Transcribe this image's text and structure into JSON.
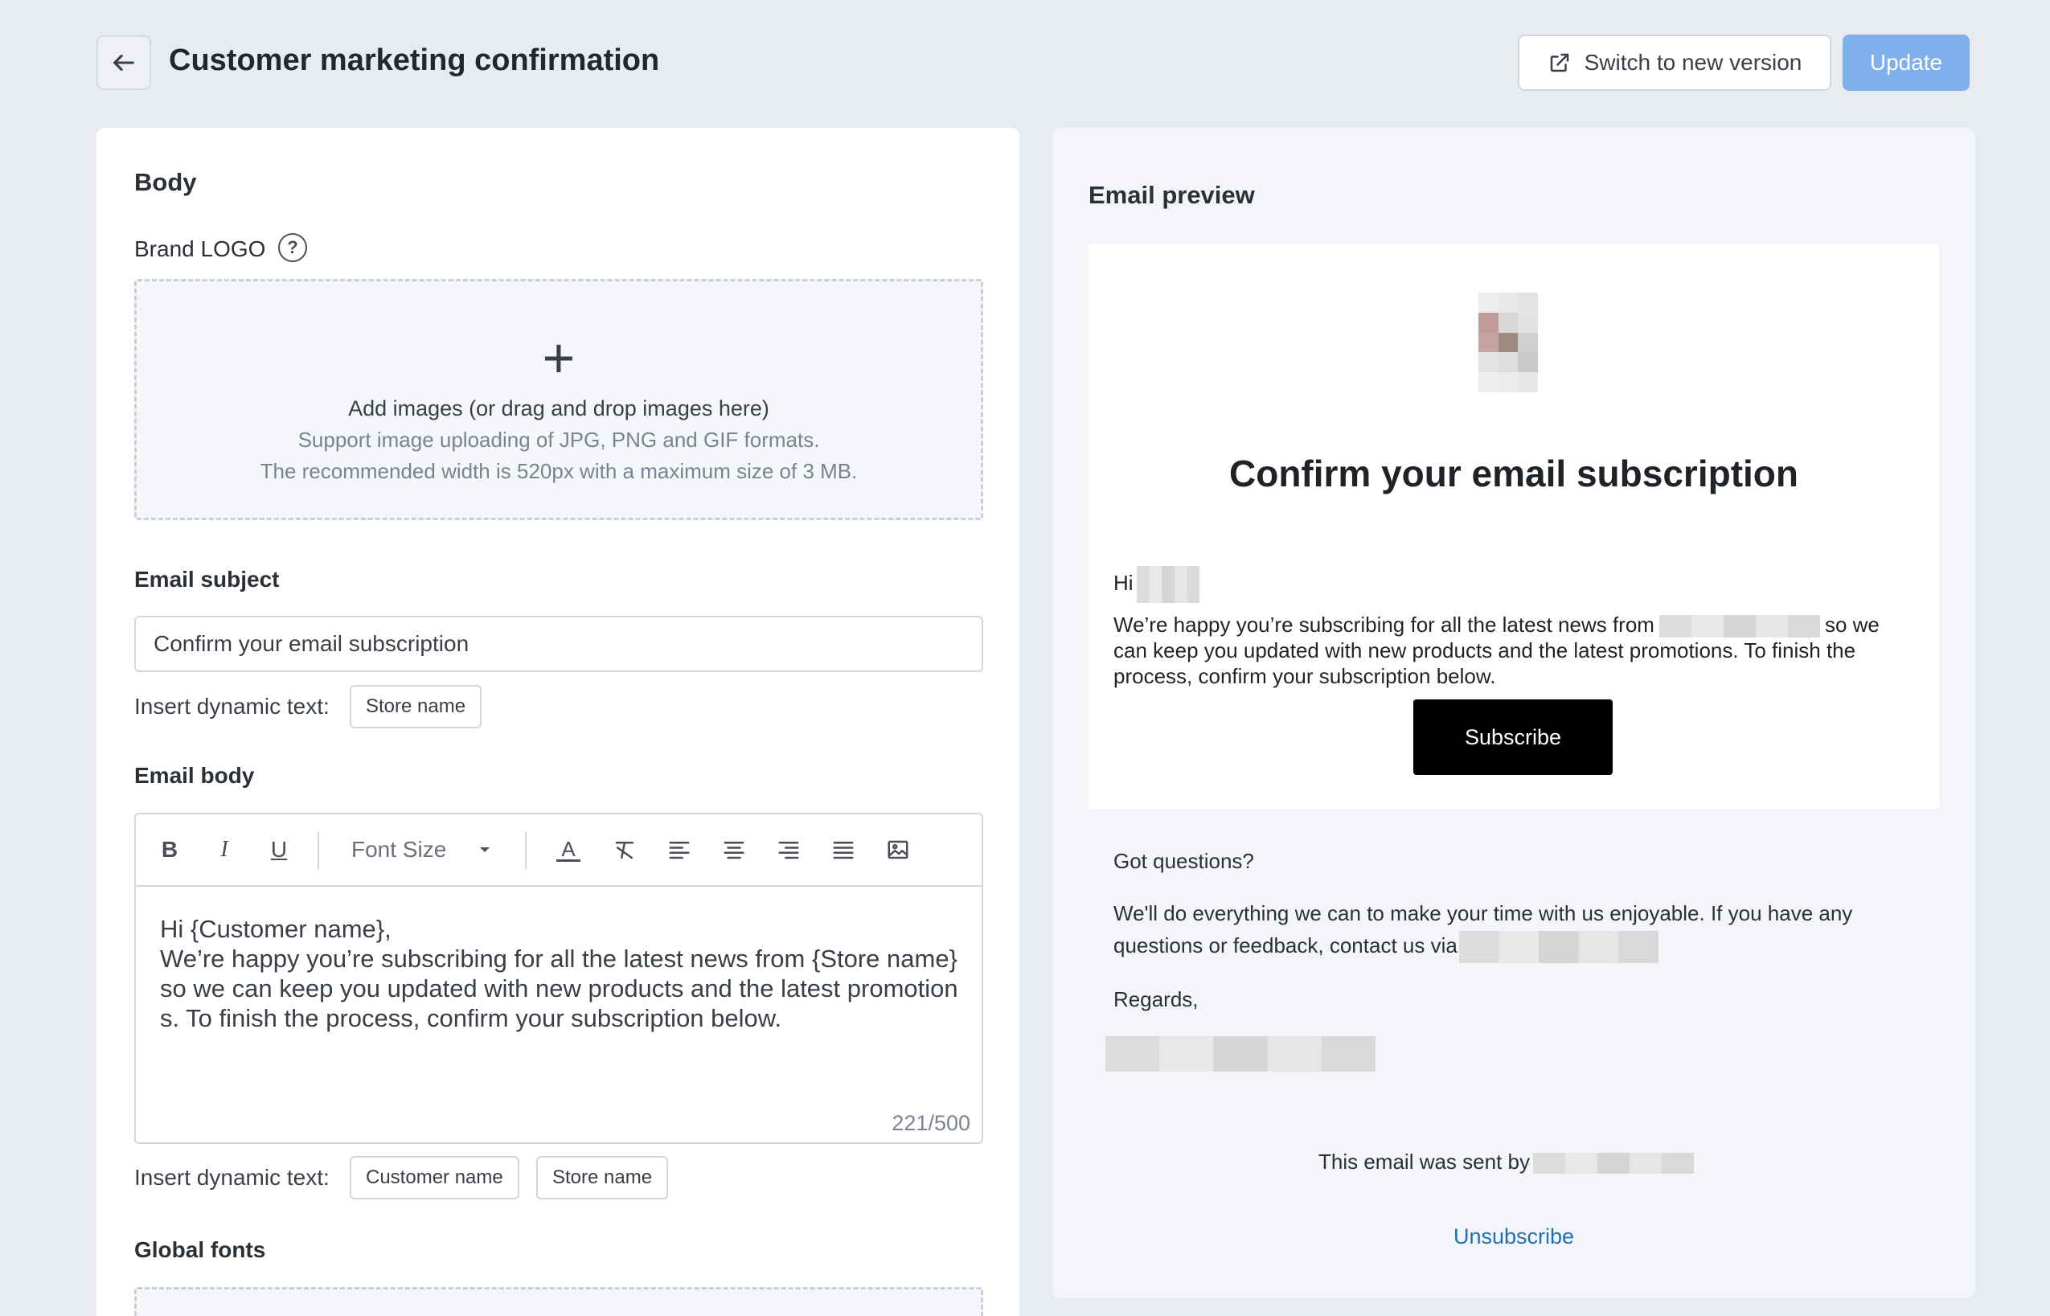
{
  "header": {
    "title": "Customer marketing confirmation",
    "switch_label": "Switch to new version",
    "update_label": "Update"
  },
  "left": {
    "body_title": "Body",
    "brand_logo_label": "Brand LOGO",
    "help_glyph": "?",
    "upload_plus": "+",
    "upload_main": "Add images (or drag and drop images here)",
    "upload_formats": "Support image uploading of JPG, PNG and GIF formats.",
    "upload_size": "The recommended width is 520px with a maximum size of 3 MB.",
    "subject_label": "Email subject",
    "subject_value": "Confirm your email subscription",
    "dynamic_label": "Insert dynamic text:",
    "subject_chips": [
      "Store name"
    ],
    "body_label": "Email body",
    "toolbar": {
      "bold": "B",
      "italic": "I",
      "underline": "U",
      "font_size": "Font Size",
      "font_color": "A"
    },
    "body_line1": "Hi {Customer name},",
    "body_line2": "We’re happy you’re subscribing for all the latest news from {Store name} so we can keep you updated with new products and the latest promotions. To finish the process, confirm your subscription below.",
    "counter": "221/500",
    "body_chips": [
      "Customer name",
      "Store name"
    ],
    "global_fonts_label": "Global fonts"
  },
  "preview": {
    "title": "Email preview",
    "headline": "Confirm your email subscription",
    "greeting": "Hi",
    "para_start": "We’re happy you’re subscribing for all the latest news from",
    "para_end": "so we can keep you updated with new products and the latest promotions. To finish the process, confirm your subscription below.",
    "subscribe_label": "Subscribe",
    "got_questions": "Got questions?",
    "support_text": "We'll do everything we can to make your time with us enjoyable. If you have any questions or feedback, contact us via",
    "regards": "Regards,",
    "sent_by": "This email was sent by",
    "unsubscribe": "Unsubscribe"
  },
  "colors": {
    "background": "#e8ebf0",
    "update_button": "#7fb0ee",
    "subscribe_button": "#000000",
    "link": "#1f6fb5"
  }
}
